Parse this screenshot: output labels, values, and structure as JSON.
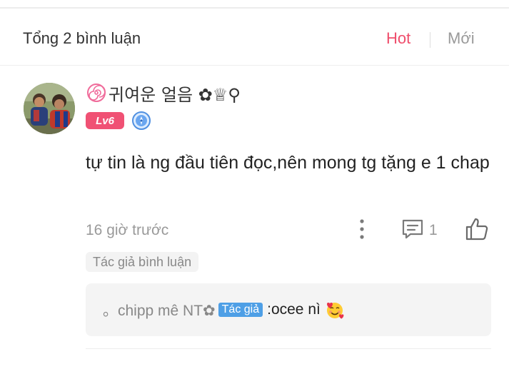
{
  "header": {
    "title": "Tổng 2 bình luận",
    "sort_hot": "Hot",
    "sort_new": "Mới",
    "active_sort_color": "#ef4e6c"
  },
  "comment": {
    "username": "귀여운 얼음 ✿♕⚲",
    "level": "Lv6",
    "level_color": "#f05174",
    "text": "tự tin là ng đầu tiên đọc,nên mong tg tặng e 1 chap",
    "timestamp": "16 giờ trước",
    "reply_count": "1",
    "author_tag": "Tác giả bình luận",
    "icons": [
      "spiral-icon",
      "medal-icon",
      "more-icon",
      "reply-icon",
      "like-icon"
    ]
  },
  "reply": {
    "author": "。chipp mê NT✿",
    "author_tag": "Tác giả",
    "author_tag_color": "#4e9fe6",
    "separator": " : ",
    "text": "ocee nì",
    "emoji": "smiling-face-with-hearts-icon"
  }
}
